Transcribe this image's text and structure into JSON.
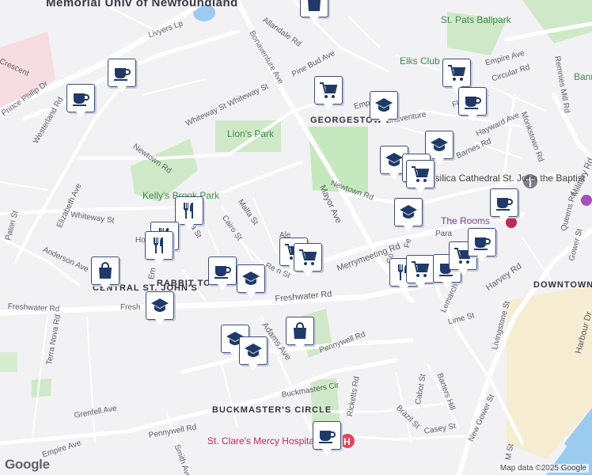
{
  "map": {
    "attribution": "Map data ©2025 Google",
    "logo": "Google"
  },
  "labels": {
    "memorial_univ": "Memorial Univ of Newfoundland",
    "st_pats": "St. Pats Ballpark",
    "elks_club": "Elks Club",
    "lions_park": "Lion's Park",
    "kellys_brook": "Kelly's Brook Park",
    "georgestown": "GEORGESTOWN",
    "rabbit_town": "RABBIT TOWN",
    "central_st_johns": "CENTRAL ST. JOHN'S",
    "downtown": "DOWNTOWN",
    "buckmasters_circle": "BUCKMASTER'S CIRCLE",
    "basilica": "Basilica Cathedral St. John the Baptist",
    "the_rooms": "The Rooms",
    "st_clares": "St. Clare's Mercy Hospital",
    "bannerman": "Banne Pa"
  },
  "streets": {
    "westerland": "Westerland Rd",
    "elizabeth": "Elizabeth Ave",
    "prince_philip": "Prince Philip Dr",
    "crescent": "Crescent",
    "livyers": "Livyers Lp",
    "bonaventure": "Bonaventure Ave",
    "allandale": "Allandale Rd",
    "pine_bud": "Pine Bud Ave",
    "whiteway_st_upper": "Whiteway St Whiteway St",
    "newtown_left": "Newtown Rd",
    "newtown_right": "Newtown Rd",
    "whiteway_st": "Whiteway St",
    "paton": "Paton St",
    "anderson": "Anderson Ave",
    "freshwater": "Freshwater Rd",
    "freshwater_left": "Fresh",
    "suvla": "Suvla St",
    "cairo": "Cairo St",
    "malta": "Malta St",
    "mayor": "Mayor Ave",
    "merrymeeting": "Merrymeeting Rd",
    "adams": "Adams Ave",
    "pennywell_upper": "Pennywell Rd",
    "pennywell_lower": "Pennywell Rd",
    "empire_lower": "Empire Ave",
    "empire_upper": "Empire Ave",
    "grenfell": "Grenfell Ave",
    "terra_nova": "Terra Nova Rd",
    "buckmasters_cir": "Buckmasters Cir",
    "ricketts": "Ricketts Rd",
    "cabot": "Cabot St",
    "brazil": "Brazil St",
    "casey": "Casey St",
    "barters_hill": "Barters Hill",
    "new_gower": "New Gower St",
    "lime": "Lime St",
    "livingstone": "Livingstone St",
    "lemarchant": "Lemarchant Rd",
    "harvey": "Harvey Rd",
    "queens": "Queens Rd",
    "military": "Military Rd",
    "monkstown": "Monkstown Rd",
    "remnies_mill": "Remnies Mill Rd",
    "circular": "Circular Rd",
    "fleming": "Fleming St",
    "hayward": "Hayward Ave",
    "barnes": "Barnes Rd",
    "gower": "Gower St",
    "harbour": "Harbour Dr",
    "smith": "Smith Ave",
    "emp_short": "Emp",
    "bonaventure_short": "onaventure",
    "alexander": "Ale",
    "rennies": "Re n St",
    "ho": "Ho",
    "em": "Em",
    "para": "Para",
    "cc": "Co",
    "fe": "Fe",
    "mst": "M St"
  },
  "markers": [
    {
      "icon": "cafe-icon",
      "name": "cafe-marker"
    },
    {
      "icon": "cafe-icon",
      "name": "cafe-marker"
    },
    {
      "icon": "shopping-bag-icon",
      "name": "shopping-marker"
    },
    {
      "icon": "shopping-cart-icon",
      "name": "grocery-marker"
    },
    {
      "icon": "shopping-cart-icon",
      "name": "grocery-marker"
    },
    {
      "icon": "school-icon",
      "name": "school-marker"
    },
    {
      "icon": "cafe-icon",
      "name": "cafe-marker"
    },
    {
      "icon": "school-icon",
      "name": "school-marker"
    },
    {
      "icon": "school-icon",
      "name": "school-marker"
    },
    {
      "icon": "shopping-cart-icon",
      "name": "grocery-marker"
    },
    {
      "icon": "shopping-cart-icon",
      "name": "grocery-marker"
    },
    {
      "icon": "school-icon",
      "name": "school-marker"
    },
    {
      "icon": "cafe-icon",
      "name": "cafe-marker"
    },
    {
      "icon": "restaurant-icon",
      "name": "restaurant-marker"
    },
    {
      "icon": "restaurant-icon",
      "name": "restaurant-marker"
    },
    {
      "icon": "restaurant-icon",
      "name": "restaurant-marker"
    },
    {
      "icon": "cafe-icon",
      "name": "cafe-marker"
    },
    {
      "icon": "school-icon",
      "name": "school-marker"
    },
    {
      "icon": "shopping-cart-icon",
      "name": "grocery-marker"
    },
    {
      "icon": "shopping-cart-icon",
      "name": "grocery-marker"
    },
    {
      "icon": "shopping-bag-icon",
      "name": "shopping-marker"
    },
    {
      "icon": "school-icon",
      "name": "school-marker"
    },
    {
      "icon": "school-icon",
      "name": "school-marker"
    },
    {
      "icon": "shopping-bag-icon",
      "name": "shopping-marker"
    },
    {
      "icon": "school-icon",
      "name": "school-marker"
    },
    {
      "icon": "restaurant-icon",
      "name": "restaurant-marker"
    },
    {
      "icon": "shopping-cart-icon",
      "name": "grocery-marker"
    },
    {
      "icon": "cafe-icon",
      "name": "cafe-marker"
    },
    {
      "icon": "shopping-cart-icon",
      "name": "grocery-marker"
    },
    {
      "icon": "cafe-icon",
      "name": "cafe-marker"
    },
    {
      "icon": "cafe-icon",
      "name": "cafe-marker"
    }
  ]
}
